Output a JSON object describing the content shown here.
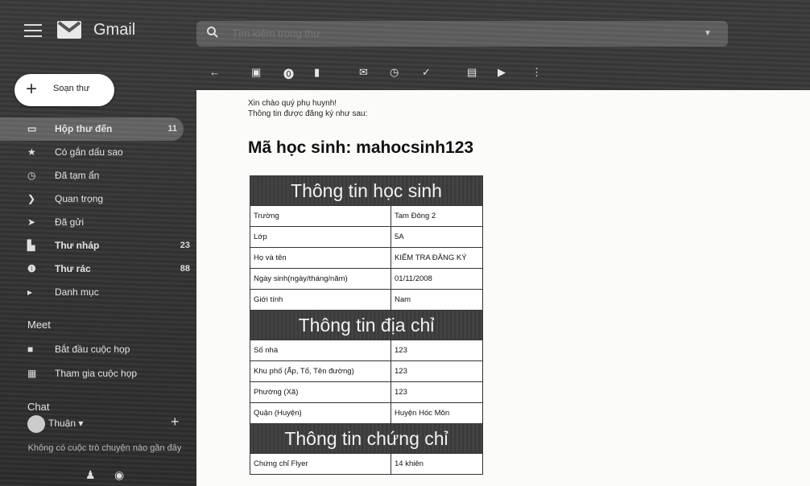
{
  "app": {
    "name": "Gmail"
  },
  "search": {
    "placeholder": "Tìm kiếm trong thư"
  },
  "compose": {
    "label": "Soạn thư"
  },
  "nav": [
    {
      "label": "Hộp thư đến",
      "count": "11",
      "icon": "inbox-icon"
    },
    {
      "label": "Có gắn dấu sao",
      "count": "",
      "icon": "star-icon"
    },
    {
      "label": "Đã tạm ẩn",
      "count": "",
      "icon": "clock-icon"
    },
    {
      "label": "Quan trọng",
      "count": "",
      "icon": "important-icon"
    },
    {
      "label": "Đã gửi",
      "count": "",
      "icon": "send-icon"
    },
    {
      "label": "Thư nháp",
      "count": "23",
      "icon": "draft-icon"
    },
    {
      "label": "Thư rác",
      "count": "88",
      "icon": "spam-icon"
    },
    {
      "label": "Danh mục",
      "count": "",
      "icon": "label-icon"
    }
  ],
  "meet": {
    "title": "Meet",
    "items": [
      "Bắt đầu cuộc họp",
      "Tham gia cuộc họp"
    ]
  },
  "chat": {
    "title": "Chat",
    "user": "Thuận",
    "empty": "Không có cuộc trò chuyện nào gần đây"
  },
  "email": {
    "greeting_1": "Xin chào quý phụ huynh!",
    "greeting_2": "Thông tin được đăng ký như sau:",
    "code_title": "Mã học sinh: mahocsinh123",
    "sections": [
      {
        "heading": "Thông tin học sinh",
        "rows": [
          [
            "Trường",
            "Tam Đông 2"
          ],
          [
            "Lớp",
            "5A"
          ],
          [
            "Họ và tên",
            "KIỂM TRA ĐĂNG KÝ"
          ],
          [
            "Ngày sinh(ngày/tháng/năm)",
            "01/11/2008"
          ],
          [
            "Giới tính",
            "Nam"
          ]
        ]
      },
      {
        "heading": "Thông tin địa chỉ",
        "rows": [
          [
            "Số nhà",
            "123"
          ],
          [
            "Khu phố (Ấp, Tổ, Tên đường)",
            "123"
          ],
          [
            "Phường (Xã)",
            "123"
          ],
          [
            "Quận (Huyện)",
            "Huyện Hóc Môn"
          ]
        ]
      },
      {
        "heading": "Thông tin chứng chỉ",
        "rows": [
          [
            "Chứng chỉ Flyer",
            "14 khiên"
          ]
        ]
      }
    ]
  },
  "colors": {
    "sidebar_bg": "#2c2c2c",
    "active_item": "#5a5a5a",
    "table_header": "#3a3a3a"
  }
}
